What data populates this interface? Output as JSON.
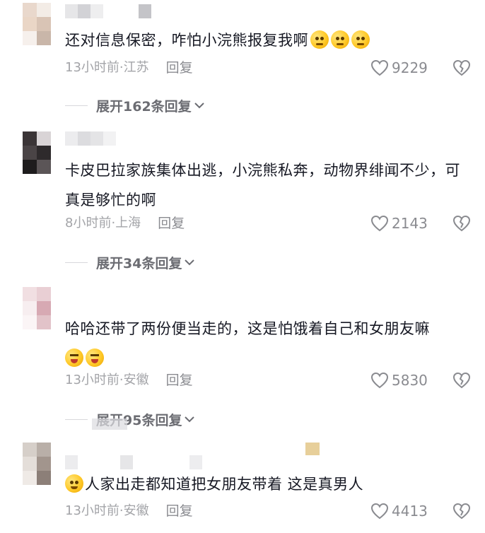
{
  "comments": [
    {
      "text": "还对信息保密，咋怕小浣熊报复我啊",
      "time": "13小时前",
      "location": "江苏",
      "reply_label": "回复",
      "likes": "9229",
      "expand": "展开162条回复"
    },
    {
      "text": "卡皮巴拉家族集体出逃，小浣熊私奔，动物界绯闻不少，可真是够忙的啊",
      "time": "8小时前",
      "location": "上海",
      "reply_label": "回复",
      "likes": "2143",
      "expand": "展开34条回复"
    },
    {
      "text": "哈哈还带了两份便当走的，这是怕饿着自己和女朋友嘛",
      "time": "13小时前",
      "location": "安徽",
      "reply_label": "回复",
      "likes": "5830",
      "expand": "展开95条回复"
    },
    {
      "text": "人家出走都知道把女朋友带着 这是真男人",
      "time": "13小时前",
      "location": "安徽",
      "reply_label": "回复",
      "likes": "4413"
    }
  ],
  "separator": " · ",
  "colors": {
    "text": "#161823",
    "meta": "#a3a4a8",
    "icon": "#8a8b90"
  },
  "icons": {
    "like": "heart-outline-icon",
    "dislike": "broken-heart-icon",
    "expand": "chevron-down-icon"
  }
}
